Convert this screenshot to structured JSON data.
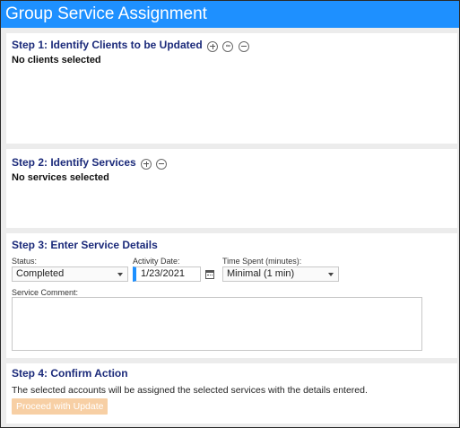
{
  "window": {
    "title": "Group Service Assignment"
  },
  "step1": {
    "title": "Step 1: Identify Clients to be Updated",
    "status": "No clients selected",
    "icons": [
      "add-icon",
      "link-icon",
      "remove-icon"
    ]
  },
  "step2": {
    "title": "Step 2: Identify Services",
    "status": "No services selected",
    "icons": [
      "add-icon",
      "remove-icon"
    ]
  },
  "step3": {
    "title": "Step 3: Enter Service Details",
    "status_label": "Status:",
    "status_value": "Completed",
    "date_label": "Activity Date:",
    "date_value": "1/23/2021",
    "time_label": "Time Spent (minutes):",
    "time_value": "Minimal (1 min)",
    "comment_label": "Service Comment:",
    "comment_value": ""
  },
  "step4": {
    "title": "Step 4: Confirm Action",
    "description": "The selected accounts will be assigned the selected services with the details entered.",
    "button_label": "Proceed with Update"
  },
  "colors": {
    "title_bar": "#1e90ff",
    "section_heading": "#1b2a7a",
    "button_disabled": "#f7cfa4"
  }
}
